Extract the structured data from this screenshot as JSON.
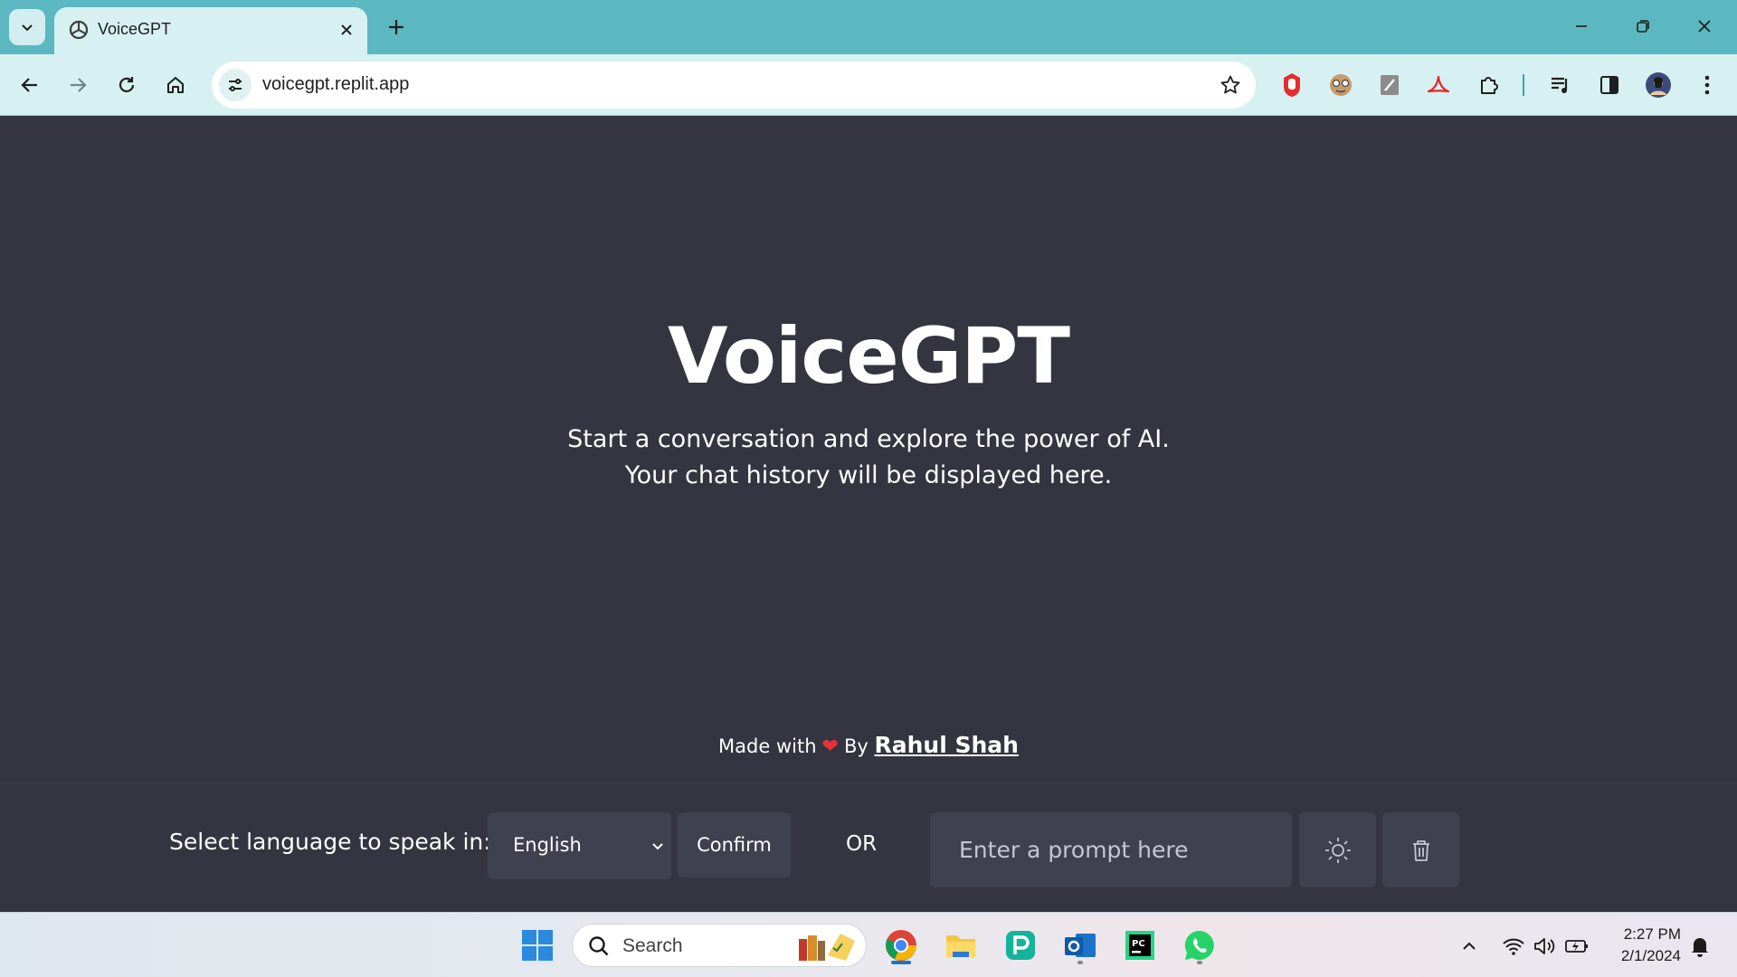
{
  "browser": {
    "tab_title": "VoiceGPT",
    "url": "voicegpt.replit.app"
  },
  "page": {
    "title": "VoiceGPT",
    "subtitle_line1": "Start a conversation and explore the power of AI.",
    "subtitle_line2": "Your chat history will be displayed here.",
    "credit_prefix": "Made with",
    "credit_by": "By",
    "credit_author": "Rahul Shah"
  },
  "controls": {
    "language_label": "Select language to speak in:",
    "language_selected": "English",
    "confirm_label": "Confirm",
    "or_label": "OR",
    "prompt_placeholder": "Enter a prompt here"
  },
  "taskbar": {
    "search_label": "Search",
    "time": "2:27 PM",
    "date": "2/1/2024"
  },
  "colors": {
    "page_bg": "#343541",
    "control_bg": "#40414f",
    "tabstrip": "#5bb8c1",
    "toolbar": "#d7f0f2"
  }
}
